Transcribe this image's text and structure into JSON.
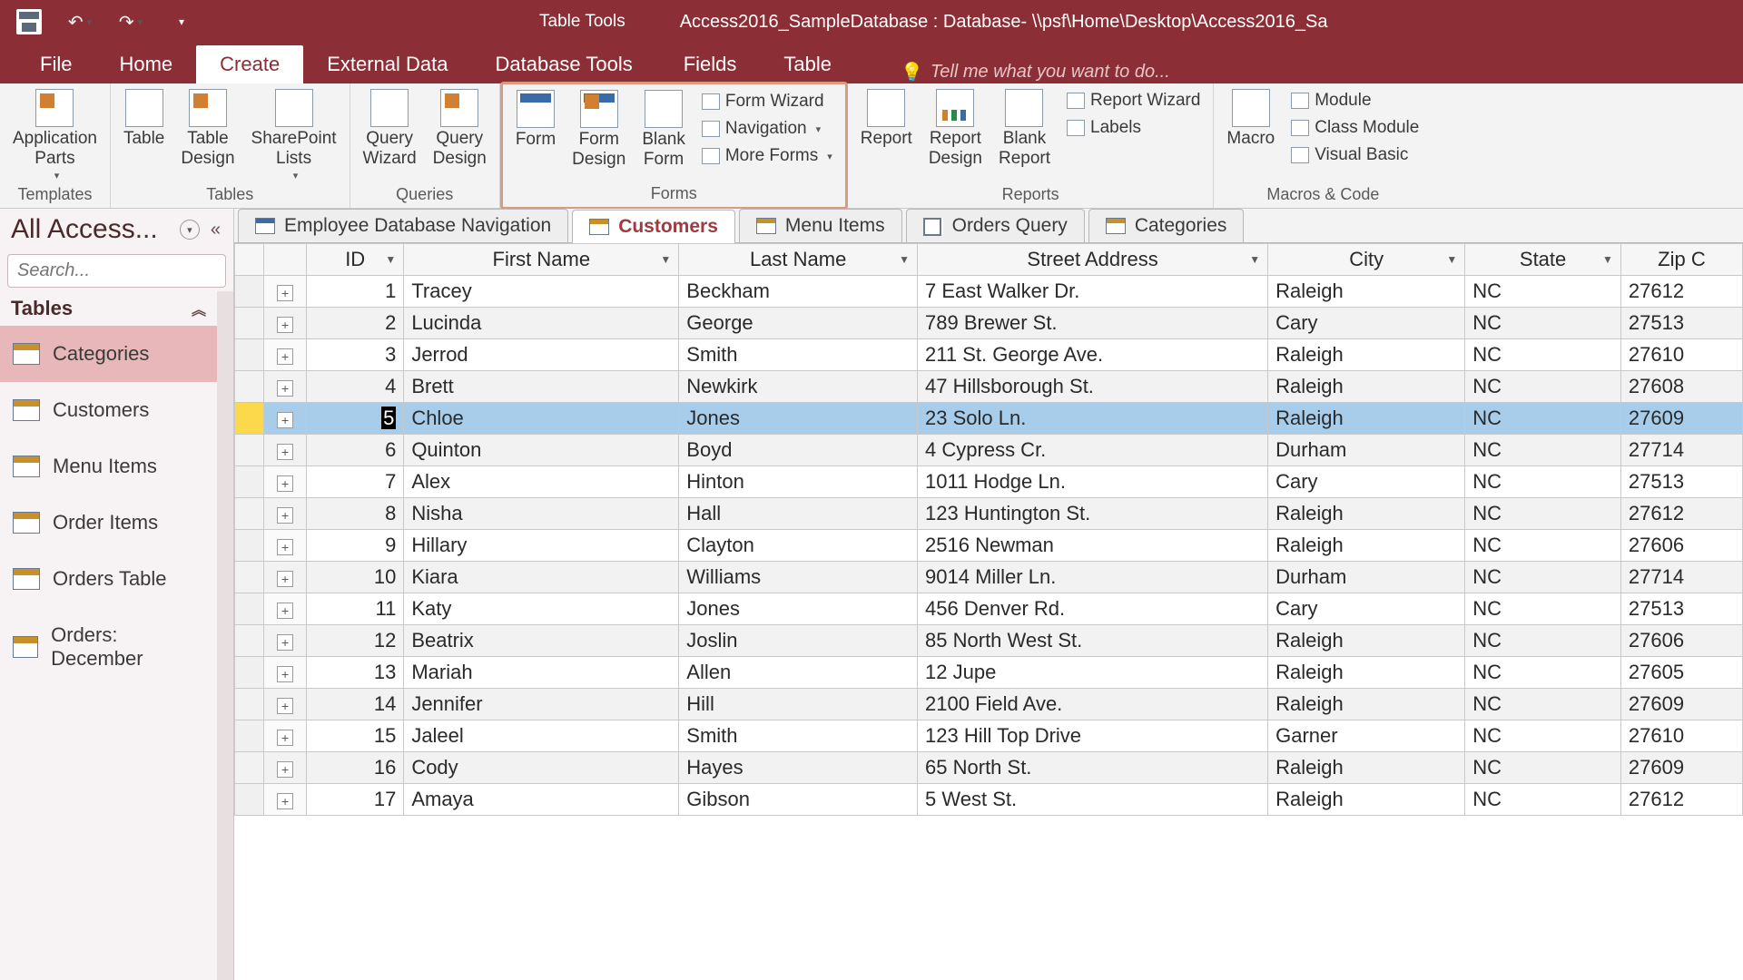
{
  "titlebar": {
    "contextual_label": "Table Tools",
    "title": "Access2016_SampleDatabase : Database- \\\\psf\\Home\\Desktop\\Access2016_Sa"
  },
  "tabs": {
    "file": "File",
    "home": "Home",
    "create": "Create",
    "external_data": "External Data",
    "database_tools": "Database Tools",
    "fields": "Fields",
    "table": "Table",
    "tell_me": "Tell me what you want to do..."
  },
  "ribbon": {
    "templates": {
      "label": "Templates",
      "application_parts": "Application\nParts"
    },
    "tables": {
      "label": "Tables",
      "table": "Table",
      "table_design": "Table\nDesign",
      "sharepoint_lists": "SharePoint\nLists"
    },
    "queries": {
      "label": "Queries",
      "query_wizard": "Query\nWizard",
      "query_design": "Query\nDesign"
    },
    "forms": {
      "label": "Forms",
      "form": "Form",
      "form_design": "Form\nDesign",
      "blank_form": "Blank\nForm",
      "form_wizard": "Form Wizard",
      "navigation": "Navigation",
      "more_forms": "More Forms"
    },
    "reports": {
      "label": "Reports",
      "report": "Report",
      "report_design": "Report\nDesign",
      "blank_report": "Blank\nReport",
      "report_wizard": "Report Wizard",
      "labels": "Labels"
    },
    "macros": {
      "label": "Macros & Code",
      "macro": "Macro",
      "module": "Module",
      "class_module": "Class Module",
      "visual_basic": "Visual Basic"
    }
  },
  "nav": {
    "title": "All Access...",
    "search_placeholder": "Search...",
    "section_tables": "Tables",
    "items": [
      {
        "label": "Categories"
      },
      {
        "label": "Customers"
      },
      {
        "label": "Menu Items"
      },
      {
        "label": "Order Items"
      },
      {
        "label": "Orders Table"
      },
      {
        "label": "Orders: December"
      }
    ]
  },
  "doctabs": [
    {
      "label": "Employee Database Navigation",
      "type": "form"
    },
    {
      "label": "Customers",
      "type": "table",
      "active": true
    },
    {
      "label": "Menu Items",
      "type": "table"
    },
    {
      "label": "Orders Query",
      "type": "query"
    },
    {
      "label": "Categories",
      "type": "table"
    }
  ],
  "columns": {
    "id": "ID",
    "first_name": "First Name",
    "last_name": "Last Name",
    "street": "Street Address",
    "city": "City",
    "state": "State",
    "zip": "Zip C"
  },
  "rows": [
    {
      "id": 1,
      "fn": "Tracey",
      "ln": "Beckham",
      "addr": "7 East Walker Dr.",
      "city": "Raleigh",
      "state": "NC",
      "zip": "27612"
    },
    {
      "id": 2,
      "fn": "Lucinda",
      "ln": "George",
      "addr": "789 Brewer St.",
      "city": "Cary",
      "state": "NC",
      "zip": "27513"
    },
    {
      "id": 3,
      "fn": "Jerrod",
      "ln": "Smith",
      "addr": "211 St. George Ave.",
      "city": "Raleigh",
      "state": "NC",
      "zip": "27610"
    },
    {
      "id": 4,
      "fn": "Brett",
      "ln": "Newkirk",
      "addr": "47 Hillsborough St.",
      "city": "Raleigh",
      "state": "NC",
      "zip": "27608"
    },
    {
      "id": 5,
      "fn": "Chloe",
      "ln": "Jones",
      "addr": "23 Solo Ln.",
      "city": "Raleigh",
      "state": "NC",
      "zip": "27609",
      "selected": true,
      "cursor": true
    },
    {
      "id": 6,
      "fn": "Quinton",
      "ln": "Boyd",
      "addr": "4 Cypress Cr.",
      "city": "Durham",
      "state": "NC",
      "zip": "27714"
    },
    {
      "id": 7,
      "fn": "Alex",
      "ln": "Hinton",
      "addr": "1011 Hodge Ln.",
      "city": "Cary",
      "state": "NC",
      "zip": "27513"
    },
    {
      "id": 8,
      "fn": "Nisha",
      "ln": "Hall",
      "addr": "123 Huntington St.",
      "city": "Raleigh",
      "state": "NC",
      "zip": "27612"
    },
    {
      "id": 9,
      "fn": "Hillary",
      "ln": "Clayton",
      "addr": "2516 Newman",
      "city": "Raleigh",
      "state": "NC",
      "zip": "27606"
    },
    {
      "id": 10,
      "fn": "Kiara",
      "ln": "Williams",
      "addr": "9014 Miller Ln.",
      "city": "Durham",
      "state": "NC",
      "zip": "27714"
    },
    {
      "id": 11,
      "fn": "Katy",
      "ln": "Jones",
      "addr": "456 Denver Rd.",
      "city": "Cary",
      "state": "NC",
      "zip": "27513"
    },
    {
      "id": 12,
      "fn": "Beatrix",
      "ln": "Joslin",
      "addr": "85 North West St.",
      "city": "Raleigh",
      "state": "NC",
      "zip": "27606"
    },
    {
      "id": 13,
      "fn": "Mariah",
      "ln": "Allen",
      "addr": "12 Jupe",
      "city": "Raleigh",
      "state": "NC",
      "zip": "27605"
    },
    {
      "id": 14,
      "fn": "Jennifer",
      "ln": "Hill",
      "addr": "2100 Field Ave.",
      "city": "Raleigh",
      "state": "NC",
      "zip": "27609"
    },
    {
      "id": 15,
      "fn": "Jaleel",
      "ln": "Smith",
      "addr": "123 Hill Top Drive",
      "city": "Garner",
      "state": "NC",
      "zip": "27610"
    },
    {
      "id": 16,
      "fn": "Cody",
      "ln": "Hayes",
      "addr": "65 North St.",
      "city": "Raleigh",
      "state": "NC",
      "zip": "27609"
    },
    {
      "id": 17,
      "fn": "Amaya",
      "ln": "Gibson",
      "addr": "5 West St.",
      "city": "Raleigh",
      "state": "NC",
      "zip": "27612"
    }
  ]
}
